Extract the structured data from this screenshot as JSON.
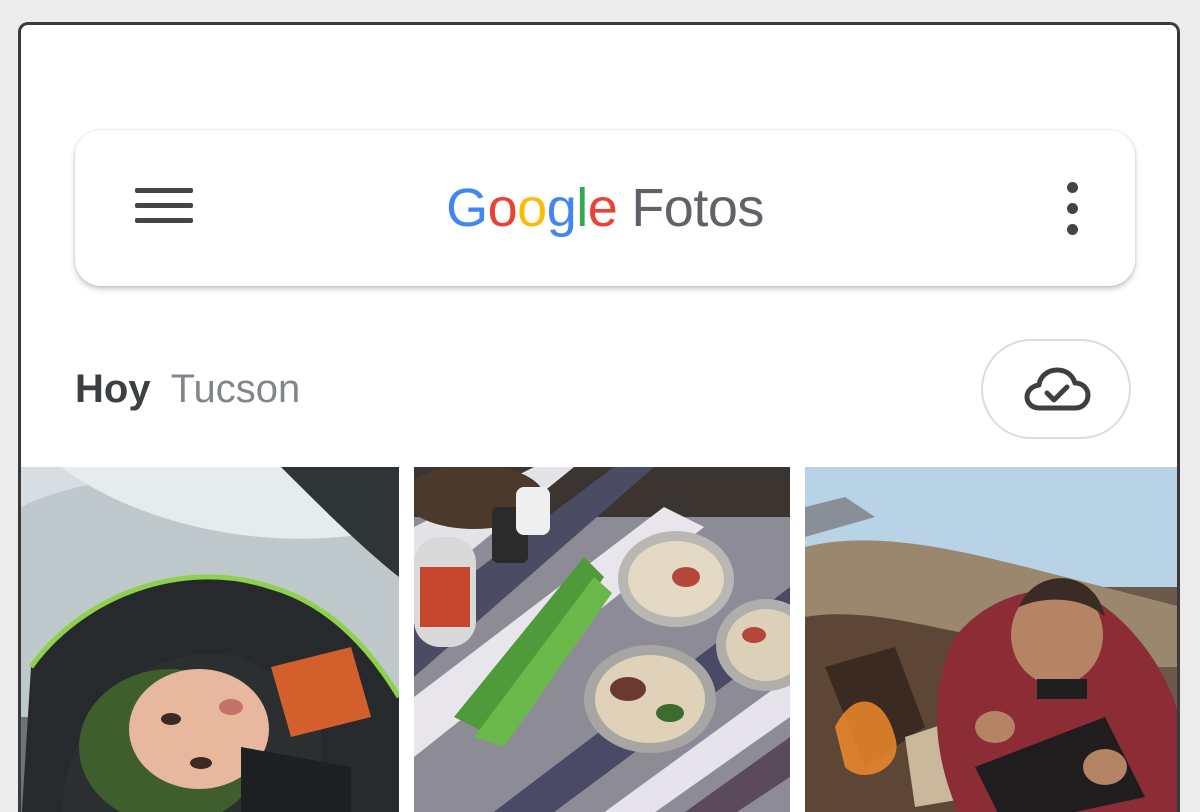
{
  "app": {
    "logo_letters": [
      "G",
      "o",
      "o",
      "g",
      "l",
      "e"
    ],
    "product_name": "Fotos"
  },
  "icons": {
    "menu": "hamburger-menu-icon",
    "more": "more-vertical-icon",
    "backup": "cloud-done-icon"
  },
  "colors": {
    "google_blue": "#4285F4",
    "google_red": "#EA4335",
    "google_yellow": "#FBBC05",
    "google_green": "#34A853"
  },
  "section": {
    "day_label": "Hoy",
    "location_label": "Tucson"
  },
  "photos": [
    {
      "id": "photo-child-in-tent"
    },
    {
      "id": "photo-camp-food"
    },
    {
      "id": "photo-man-at-campfire"
    }
  ]
}
